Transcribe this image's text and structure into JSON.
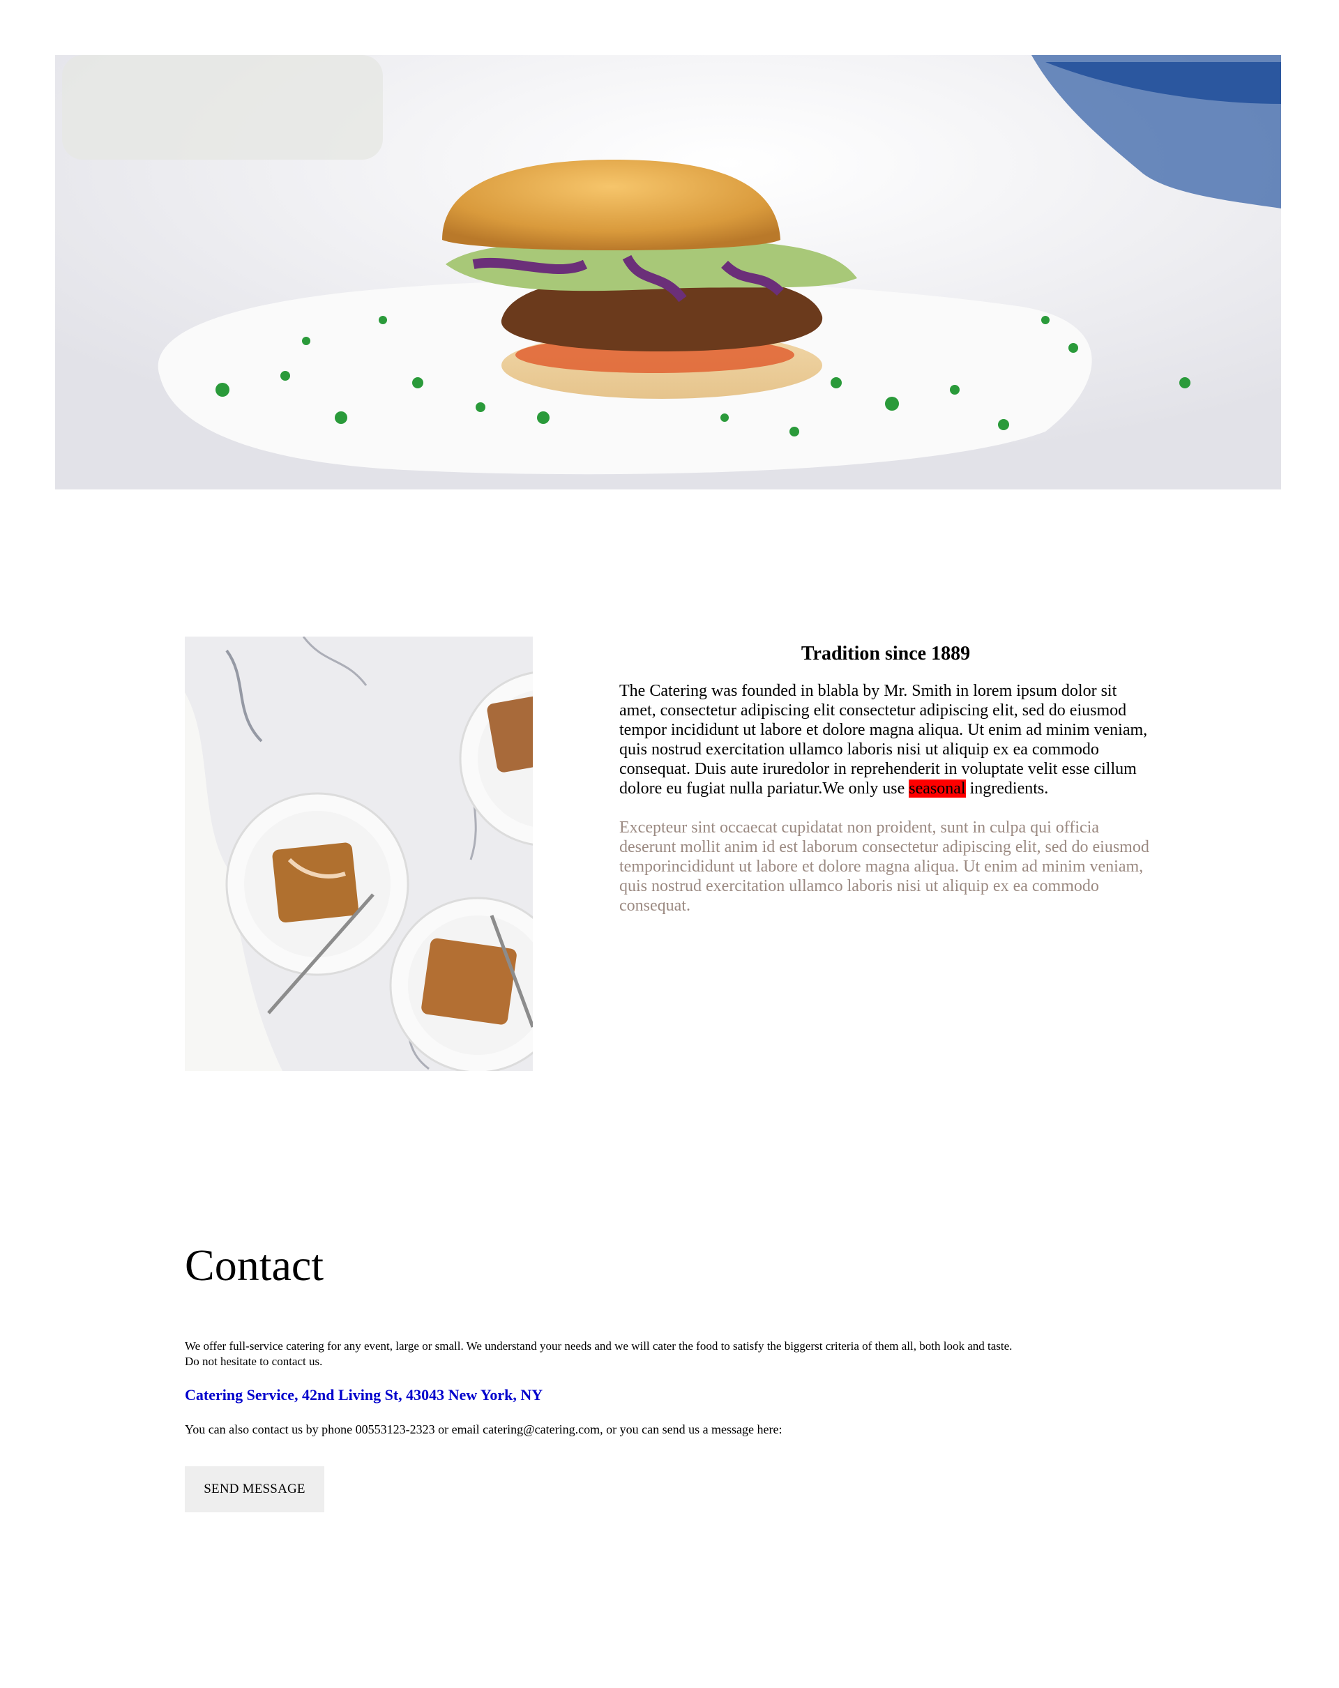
{
  "hero": {
    "image_description_icon": "burger-photo"
  },
  "about": {
    "image_icon": "pie-plates-photo",
    "title": "Tradition since 1889",
    "paragraph1_before": "The Catering was founded in blabla by Mr. Smith in lorem ipsum dolor sit amet, consectetur adipiscing elit consectetur adipiscing elit, sed do eiusmod tempor incididunt ut labore et dolore magna aliqua. Ut enim ad minim veniam, quis nostrud exercitation ullamco laboris nisi ut aliquip ex ea commodo consequat. Duis aute iruredolor in reprehenderit in voluptate velit esse cillum dolore eu fugiat nulla pariatur.We only use ",
    "paragraph1_highlight": "seasonal",
    "paragraph1_after": " ingredients.",
    "paragraph2": "Excepteur sint occaecat cupidatat non proident, sunt in culpa qui officia deserunt mollit anim id est laborum consectetur adipiscing elit, sed do eiusmod temporincididunt ut labore et dolore magna aliqua. Ut enim ad minim veniam, quis nostrud exercitation ullamco laboris nisi ut aliquip ex ea commodo consequat.",
    "highlight_color": "#ff0000",
    "muted_color": "#9b8a82"
  },
  "contact": {
    "title": "Contact",
    "intro_line1": "We offer full-service catering for any event, large or small. We understand your needs and we will cater the food to satisfy the biggerst criteria of them all, both look and taste.",
    "intro_line2": "Do not hesitate to contact us.",
    "address": "Catering Service, 42nd Living St, 43043 New York, NY",
    "extra": "You can also contact us by phone 00553123-2323 or email catering@catering.com, or you can send us a message here:",
    "send_button": "SEND MESSAGE",
    "address_color": "#0000cc"
  }
}
